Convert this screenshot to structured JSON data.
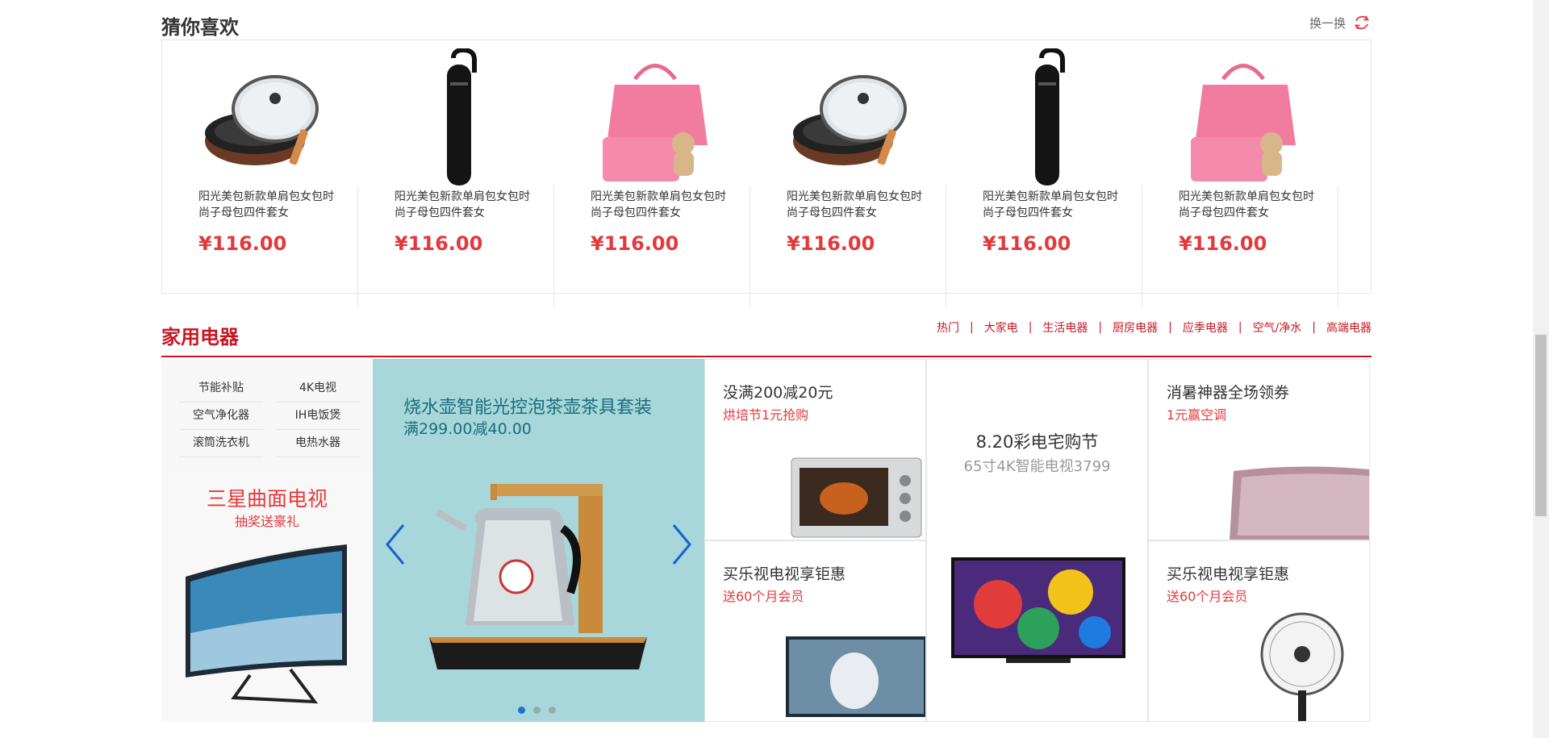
{
  "guess": {
    "title": "猜你喜欢",
    "refresh_label": "换一换",
    "items": [
      {
        "desc": "阳光美包新款单肩包女包时尚子母包四件套女",
        "price": "¥116.00",
        "image": "pan"
      },
      {
        "desc": "阳光美包新款单肩包女包时尚子母包四件套女",
        "price": "¥116.00",
        "image": "earpiece"
      },
      {
        "desc": "阳光美包新款单肩包女包时尚子母包四件套女",
        "price": "¥116.00",
        "image": "handbag"
      },
      {
        "desc": "阳光美包新款单肩包女包时尚子母包四件套女",
        "price": "¥116.00",
        "image": "pan"
      },
      {
        "desc": "阳光美包新款单肩包女包时尚子母包四件套女",
        "price": "¥116.00",
        "image": "earpiece"
      },
      {
        "desc": "阳光美包新款单肩包女包时尚子母包四件套女",
        "price": "¥116.00",
        "image": "handbag"
      }
    ]
  },
  "appliances": {
    "title": "家用电器",
    "tabs": [
      "热门",
      "大家电",
      "生活电器",
      "厨房电器",
      "应季电器",
      "空气/净水",
      "高端电器"
    ],
    "quick_links": [
      "节能补贴",
      "4K电视",
      "空气净化器",
      "IH电饭煲",
      "滚筒洗衣机",
      "电热水器"
    ],
    "tv_promo": {
      "title": "三星曲面电视",
      "subtitle": "抽奖送豪礼"
    },
    "carousel": {
      "title": "烧水壶智能光控泡茶壶茶具套装",
      "subtitle": "满299.00减40.00",
      "dots": 3,
      "active_dot": 0
    },
    "cells": [
      {
        "title": "没满200减20元",
        "subtitle": "烘培节1元抢购"
      },
      {
        "title": "买乐视电视享钜惠",
        "subtitle": "送60个月会员"
      },
      {
        "title": "8.20彩电宅购节",
        "subtitle": "65寸4K智能电视3799"
      },
      {
        "title": "消暑神器全场领券",
        "subtitle": "1元赢空调"
      },
      {
        "title": "买乐视电视享钜惠",
        "subtitle": "送60个月会员"
      }
    ]
  },
  "colors": {
    "accent": "#c81623",
    "price": "#e4393c",
    "carousel_bg": "#a7d6db"
  }
}
